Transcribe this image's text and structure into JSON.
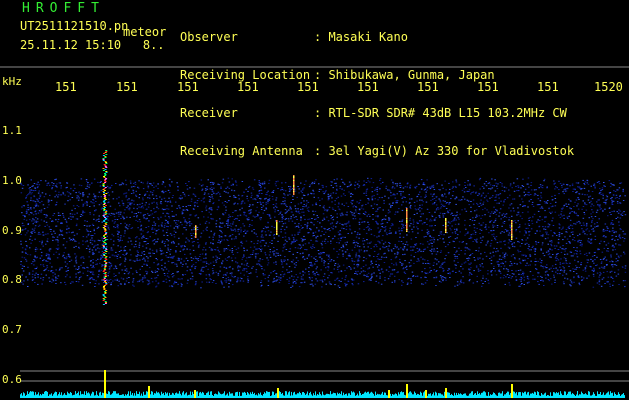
{
  "header": {
    "brand": "HROFFT",
    "file_name": "UT2511121510.pn",
    "meteor_label": "meteor",
    "datetime": "25.11.12 15:10",
    "datetime_extra": "8..",
    "info": [
      {
        "key": "Observer",
        "value": ": Masaki Kano"
      },
      {
        "key": "Receiving Location",
        "value": ": Shibukawa, Gunma, Japan"
      },
      {
        "key": "Receiver",
        "value": ": RTL-SDR SDR# 43dB L15 103.2MHz CW"
      },
      {
        "key": "Receiving Antenna",
        "value": ": 3el Yagi(V) Az 330 for Vladivostok"
      }
    ]
  },
  "axes": {
    "y_unit": "kHz",
    "x_ticks": [
      "151",
      "151",
      "151",
      "151",
      "151",
      "151",
      "151",
      "151",
      "151",
      "1520"
    ],
    "y_ticks": [
      "1.1",
      "1.0",
      "0.9",
      "0.8",
      "0.7",
      "0.6"
    ]
  },
  "colors": {
    "text": "#ffff55",
    "brand": "#33ee33",
    "background": "#000000",
    "noise": "#1a2aaa",
    "signal": "#ffff00",
    "baseline": "#00e5ff"
  }
}
